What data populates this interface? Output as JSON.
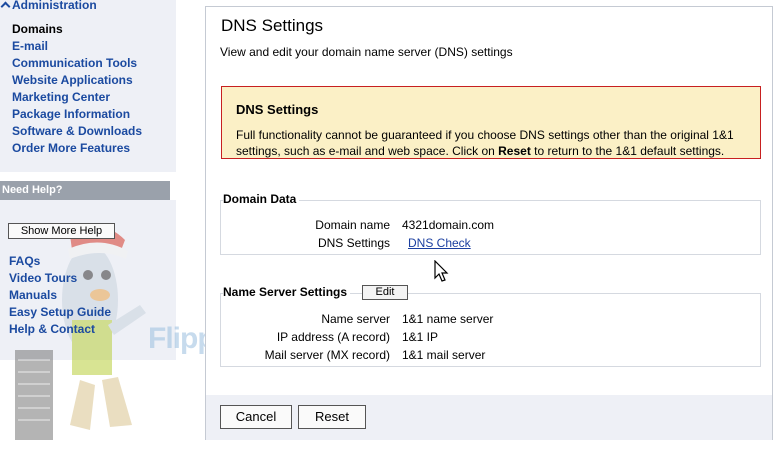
{
  "sidebar": {
    "section_title": "Administration",
    "items": [
      {
        "label": "Domains"
      },
      {
        "label": "E-mail"
      },
      {
        "label": "Communication Tools"
      },
      {
        "label": "Website Applications"
      },
      {
        "label": "Marketing Center"
      },
      {
        "label": "Package Information"
      },
      {
        "label": "Software & Downloads"
      },
      {
        "label": "Order More Features"
      }
    ],
    "help": {
      "title": "Need Help?",
      "show_more_label": "Show More Help",
      "links": [
        {
          "label": "FAQs"
        },
        {
          "label": "Video Tours"
        },
        {
          "label": "Manuals"
        },
        {
          "label": "Easy Setup Guide"
        },
        {
          "label": "Help & Contact"
        }
      ]
    }
  },
  "watermark": {
    "text": "FlipperHo"
  },
  "main": {
    "title": "DNS Settings",
    "description": "View and edit your domain name server (DNS) settings",
    "warning": {
      "title": "DNS Settings",
      "text_before": "Full functionality cannot be guaranteed if you choose DNS settings other than the original 1&1 settings, such as e-mail and web space. Click on ",
      "text_bold": "Reset",
      "text_after": " to return to the 1&1 default settings."
    },
    "domain_data": {
      "title": "Domain Data",
      "rows": [
        {
          "label": "Domain name",
          "value": "4321domain.com"
        },
        {
          "label": "DNS Settings",
          "value": "DNS Check"
        }
      ]
    },
    "name_server": {
      "title": "Name Server Settings",
      "edit_label": "Edit",
      "rows": [
        {
          "label": "Name server",
          "value": "1&1 name server"
        },
        {
          "label": "IP address (A record)",
          "value": "1&1 IP"
        },
        {
          "label": "Mail server (MX record)",
          "value": "1&1 mail server"
        }
      ]
    },
    "buttons": {
      "cancel": "Cancel",
      "reset": "Reset"
    }
  },
  "colors": {
    "link": "#1b4aa0",
    "warning_bg": "#fbf0c6",
    "warning_border": "#c72020",
    "help_bar": "#9aa1ab"
  }
}
